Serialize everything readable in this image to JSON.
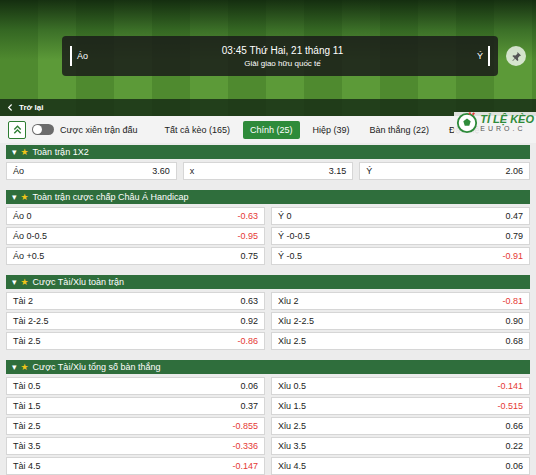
{
  "banner": {
    "home": "Áo",
    "away": "Ý",
    "time": "03:45 Thứ Hai, 21 tháng 11",
    "league": "Giải giao hữu quốc tế",
    "back": "Trở lại"
  },
  "toolbar": {
    "toggle": {
      "label": "Cược xiên trận đấu",
      "on": false
    },
    "tabs": [
      {
        "label": "Tất cả kèo (165)",
        "selected": false
      },
      {
        "label": "Chính (25)",
        "selected": true
      },
      {
        "label": "Hiệp (39)",
        "selected": false
      },
      {
        "label": "Bàn thắng (22)",
        "selected": false
      },
      {
        "label": "Đặc biệ",
        "selected": false
      }
    ]
  },
  "logo": {
    "title": "TỈ LỆ KÈO",
    "domain": "EURO.C"
  },
  "section_marks": {
    "caret": "▾",
    "star": "★"
  },
  "sections": [
    {
      "title": "Toàn trận 1X2",
      "columns": 3,
      "rows": [
        [
          {
            "label": "Áo",
            "odds": "3.60"
          },
          {
            "label": "x",
            "odds": "3.15"
          },
          {
            "label": "Ý",
            "odds": "2.06"
          }
        ]
      ]
    },
    {
      "title": "Toàn trận cược chấp Châu Á Handicap",
      "columns": 2,
      "rows": [
        [
          {
            "label": "Áo 0",
            "odds": "-0.63"
          },
          {
            "label": "Ý 0",
            "odds": "0.47"
          }
        ],
        [
          {
            "label": "Áo 0-0.5",
            "odds": "-0.95"
          },
          {
            "label": "Ý -0-0.5",
            "odds": "0.79"
          }
        ],
        [
          {
            "label": "Áo +0.5",
            "odds": "0.75"
          },
          {
            "label": "Ý -0.5",
            "odds": "-0.91"
          }
        ]
      ]
    },
    {
      "title": "Cược Tài/Xỉu toàn trận",
      "columns": 2,
      "rows": [
        [
          {
            "label": "Tài 2",
            "odds": "0.63"
          },
          {
            "label": "Xỉu 2",
            "odds": "-0.81"
          }
        ],
        [
          {
            "label": "Tài 2-2.5",
            "odds": "0.92"
          },
          {
            "label": "Xỉu 2-2.5",
            "odds": "0.90"
          }
        ],
        [
          {
            "label": "Tài 2.5",
            "odds": "-0.86"
          },
          {
            "label": "Xỉu 2.5",
            "odds": "0.68"
          }
        ]
      ]
    },
    {
      "title": "Cược Tài/Xỉu tổng số bàn thắng",
      "columns": 2,
      "rows": [
        [
          {
            "label": "Tài 0.5",
            "odds": "0.06"
          },
          {
            "label": "Xỉu 0.5",
            "odds": "-0.141"
          }
        ],
        [
          {
            "label": "Tài 1.5",
            "odds": "0.37"
          },
          {
            "label": "Xỉu 1.5",
            "odds": "-0.515"
          }
        ],
        [
          {
            "label": "Tài 2.5",
            "odds": "-0.855"
          },
          {
            "label": "Xỉu 2.5",
            "odds": "0.66"
          }
        ],
        [
          {
            "label": "Tài 3.5",
            "odds": "-0.336"
          },
          {
            "label": "Xỉu 3.5",
            "odds": "0.22"
          }
        ],
        [
          {
            "label": "Tài 4.5",
            "odds": "-0.147"
          },
          {
            "label": "Xỉu 4.5",
            "odds": "0.06"
          }
        ]
      ]
    }
  ]
}
